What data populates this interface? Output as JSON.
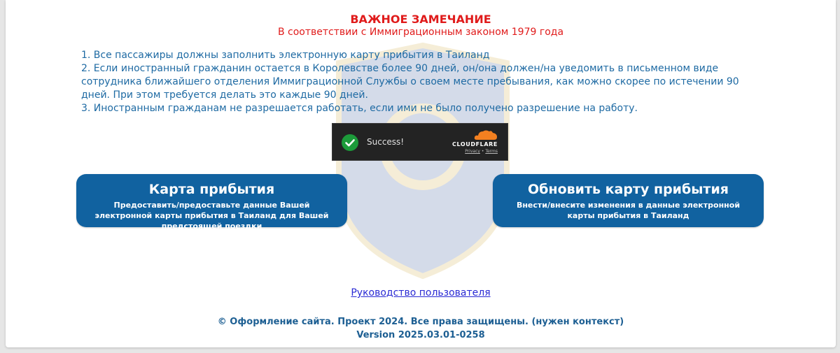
{
  "notice": {
    "title": "ВАЖНОЕ ЗАМЕЧАНИЕ",
    "subtitle": "В соответствии с Иммиграционным законом 1979 года",
    "items": [
      "1. Все пассажиры должны заполнить электронную карту прибытия в Таиланд",
      "2. Если иностранный гражданин остается в Королевстве более 90 дней, он/она должен/на уведомить в письменном виде сотрудника ближайшего отделения Иммиграционной Службы о своем месте пребывания, как можно скорее по истечении 90 дней. При этом требуется делать это каждые 90 дней.",
      "3. Иностранным гражданам не разрешается работать, если ими не было получено разрешение на работу."
    ]
  },
  "captcha": {
    "status": "Success!",
    "brand": "CLOUDFLARE",
    "privacy": "Privacy",
    "separator": "•",
    "terms": "Terms"
  },
  "actions": {
    "arrival": {
      "title": "Карта прибытия",
      "description": "Предоставить/предоставьте данные Вашей электронной карты прибытия в Таиланд для Вашей предстоящей поездки"
    },
    "update": {
      "title": "Обновить карту прибытия",
      "description": "Внести/внесите изменения в данные электронной карты прибытия в Таиланд"
    }
  },
  "links": {
    "manual": "Руководство пользователя"
  },
  "footer": {
    "copyright": "© Оформление сайта. Проект 2024. Все права защищены. (нужен контекст)",
    "version": "Version 2025.03.01-0258"
  },
  "colors": {
    "accent_red": "#e01b1b",
    "text_blue": "#1e6aa3",
    "button_blue": "#1162a0",
    "link_blue": "#2a2ad4",
    "success_green": "#1c9b3a",
    "cloudflare_orange": "#f38020"
  }
}
